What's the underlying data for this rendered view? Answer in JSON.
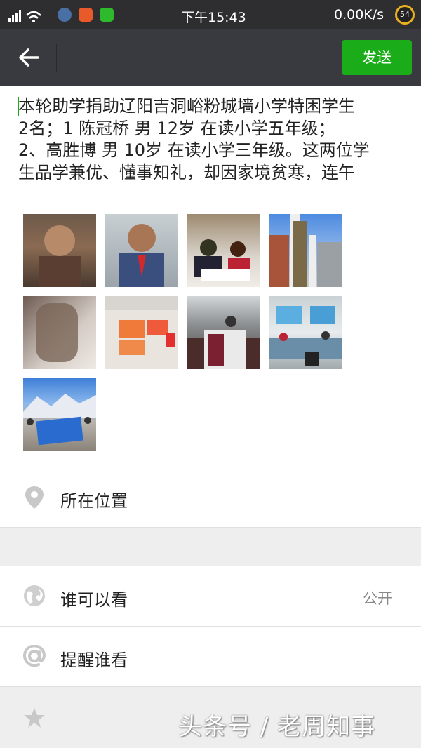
{
  "status_bar": {
    "time": "下午15:43",
    "network_speed": "0.00K/s",
    "battery": "54"
  },
  "toolbar": {
    "send_label": "发送"
  },
  "post": {
    "lines": [
      "本轮助学捐助辽阳吉洞峪粉城墙小学特困学生",
      "2名；1 陈冠桥 男 12岁  在读小学五年级；",
      "2、高胜博 男 10岁 在读小学三年级。这两位学",
      "生品学兼优、懂事知礼，却因家境贫寒，连午"
    ]
  },
  "photos": [
    {
      "name": "boy-portrait-1"
    },
    {
      "name": "boy-portrait-2"
    },
    {
      "name": "students-desk"
    },
    {
      "name": "school-gate"
    },
    {
      "name": "child-coat"
    },
    {
      "name": "wall-certificates"
    },
    {
      "name": "room-interior"
    },
    {
      "name": "classroom"
    },
    {
      "name": "group-banner"
    }
  ],
  "options": {
    "location_label": "所在位置",
    "visibility_label": "谁可以看",
    "visibility_value": "公开",
    "remind_label": "提醒谁看"
  },
  "watermark": "头条号 / 老周知事"
}
